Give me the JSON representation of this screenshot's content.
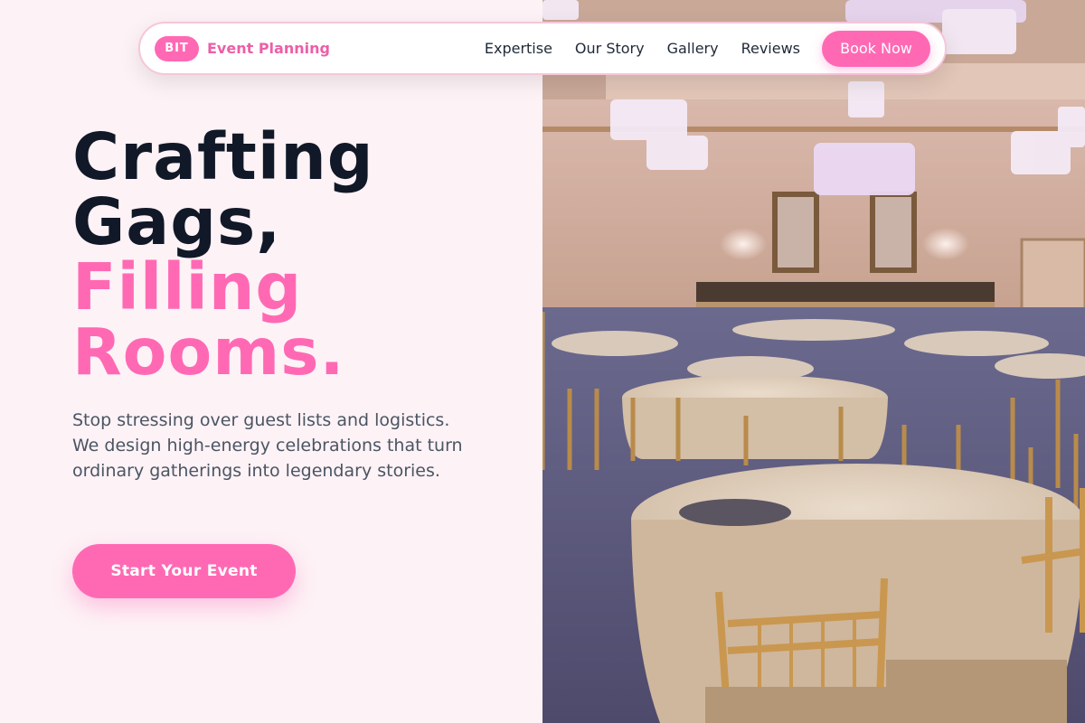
{
  "nav": {
    "brand_badge": "BIT",
    "brand_name": "Event Planning",
    "links": [
      "Expertise",
      "Our Story",
      "Gallery",
      "Reviews"
    ],
    "cta_label": "Book Now"
  },
  "hero": {
    "headline_dark_1": "Crafting",
    "headline_dark_2": "Gags,",
    "headline_pink_1": "Filling",
    "headline_pink_2": "Rooms.",
    "subtext": "Stop stressing over guest lists and logistics. We design high-energy celebrations that turn ordinary gatherings into legendary stories.",
    "cta_label": "Start Your Event",
    "image_subject": "ballroom-banquet-photo"
  },
  "colors": {
    "accent": "#ff69b4",
    "brand_text": "#ec5fa7",
    "heading": "#111827",
    "body_text": "#4b5563",
    "background": "#fdf2f6"
  }
}
